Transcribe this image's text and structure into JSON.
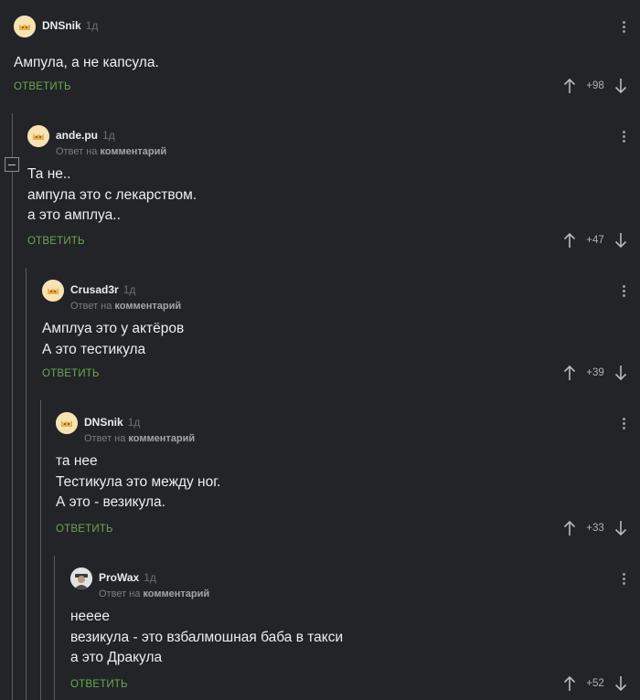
{
  "comments": [
    {
      "author": "DNSnik",
      "time": "1д",
      "reply_prefix": "",
      "reply_target": "",
      "lines": [
        "Ампула, а не капсула."
      ],
      "reply_label": "ОТВЕТИТЬ",
      "score": "+98",
      "avatar_icon": "cat-avatar-icon"
    },
    {
      "author": "ande.pu",
      "time": "1д",
      "reply_prefix": "Ответ на",
      "reply_target": "комментарий",
      "lines": [
        "Та не..",
        "ампула это с лекарством.",
        "а это амплуа.."
      ],
      "reply_label": "ОТВЕТИТЬ",
      "score": "+47",
      "avatar_icon": "cat-avatar-icon"
    },
    {
      "author": "Crusad3r",
      "time": "1д",
      "reply_prefix": "Ответ на",
      "reply_target": "комментарий",
      "lines": [
        "Амплуа это у актёров",
        "А это тестикула"
      ],
      "reply_label": "ОТВЕТИТЬ",
      "score": "+39",
      "avatar_icon": "cat-avatar-icon"
    },
    {
      "author": "DNSnik",
      "time": "1д",
      "reply_prefix": "Ответ на",
      "reply_target": "комментарий",
      "lines": [
        "та нее",
        "Тестикула это между ног.",
        "А это - везикула."
      ],
      "reply_label": "ОТВЕТИТЬ",
      "score": "+33",
      "avatar_icon": "cat-avatar-icon"
    },
    {
      "author": "ProWax",
      "time": "1д",
      "reply_prefix": "Ответ на",
      "reply_target": "комментарий",
      "lines": [
        "неeee",
        "везикула - это взбалмошная баба в такси",
        "а это Дракула"
      ],
      "reply_label": "ОТВЕТИТЬ",
      "score": "+52",
      "avatar_icon": "person-avatar-icon"
    }
  ],
  "colors": {
    "background": "#222427",
    "reply_button": "#6aa84f",
    "thread_line": "#5a5c60"
  }
}
